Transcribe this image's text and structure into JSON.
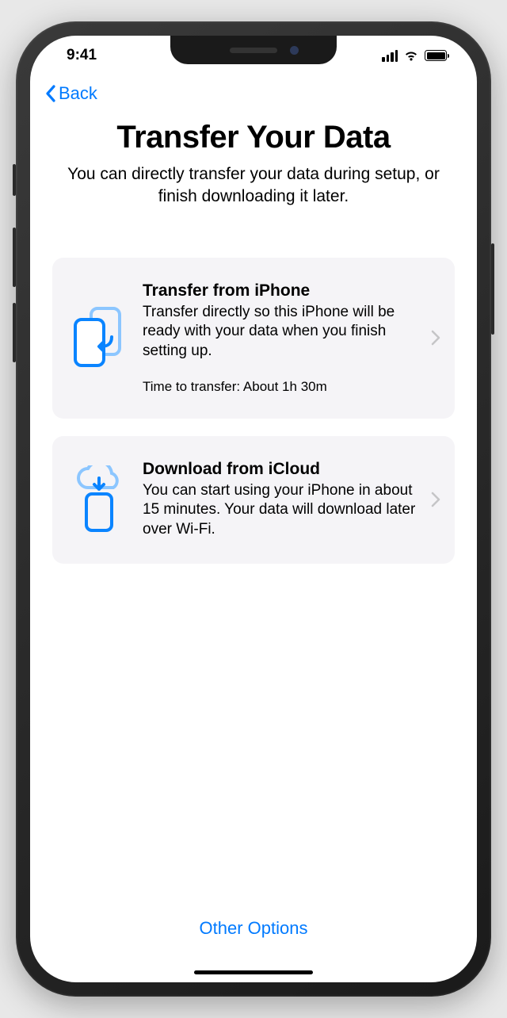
{
  "statusBar": {
    "time": "9:41"
  },
  "nav": {
    "back": "Back"
  },
  "header": {
    "title": "Transfer Your Data",
    "subtitle": "You can directly transfer your data during setup, or finish downloading it later."
  },
  "options": [
    {
      "title": "Transfer from iPhone",
      "description": "Transfer directly so this iPhone will be ready with your data when you finish setting up.",
      "meta": "Time to transfer: About 1h 30m"
    },
    {
      "title": "Download from iCloud",
      "description": "You can start using your iPhone in about 15 minutes. Your data will download later over Wi-Fi."
    }
  ],
  "footer": {
    "otherOptions": "Other Options"
  },
  "colors": {
    "accent": "#007aff",
    "cardBg": "#f5f4f7"
  }
}
